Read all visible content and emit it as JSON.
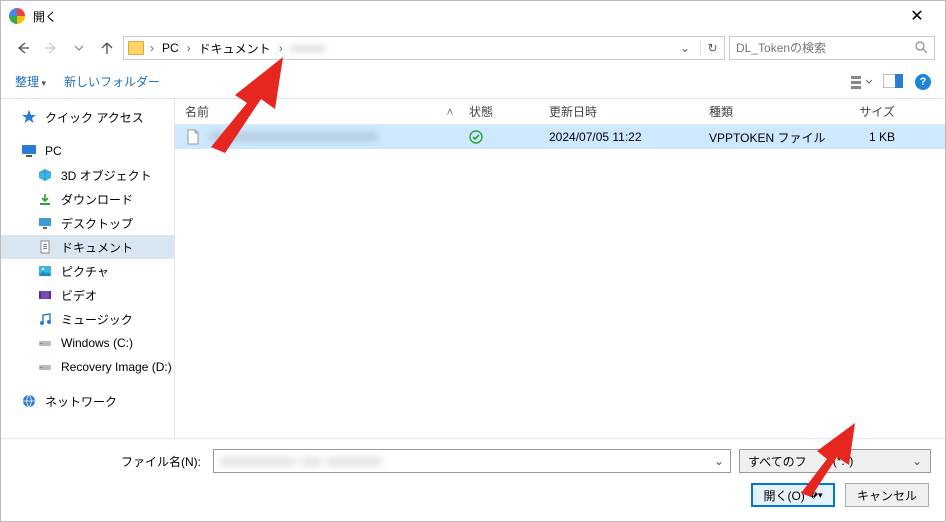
{
  "title": "開く",
  "nav": {
    "crumbs": [
      "PC",
      "ドキュメント"
    ],
    "blur_tail": "xxxxx"
  },
  "search": {
    "placeholder": "DL_Tokenの検索"
  },
  "toolbar": {
    "organize": "整理",
    "newfolder": "新しいフォルダー"
  },
  "sidebar": {
    "quick": "クイック アクセス",
    "pc": "PC",
    "items": [
      "3D オブジェクト",
      "ダウンロード",
      "デスクトップ",
      "ドキュメント",
      "ピクチャ",
      "ビデオ",
      "ミュージック",
      "Windows (C:)",
      "Recovery Image (D:)"
    ],
    "network": "ネットワーク"
  },
  "columns": {
    "name": "名前",
    "status": "状態",
    "date": "更新日時",
    "kind": "種類",
    "size": "サイズ"
  },
  "rows": [
    {
      "name_blur": "xxxxxxxxxxxxxxxxxxxxxxxx",
      "date": "2024/07/05 11:22",
      "kind": "VPPTOKEN ファイル",
      "size": "1 KB",
      "status": "synced"
    }
  ],
  "bottom": {
    "filename_label": "ファイル名(N):",
    "filename_blur": "xxxxxxxxxxx  xxx  xxxxxxxx",
    "filter_label_prefix": "すべてのフ",
    "filter_label_suffix": "(*.*)",
    "open": "開く(O)",
    "cancel": "キャンセル"
  }
}
